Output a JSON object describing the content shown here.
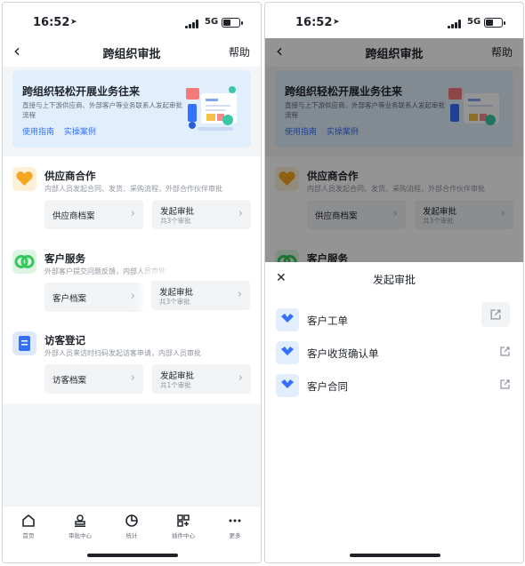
{
  "status": {
    "time": "16:52",
    "network": "5G"
  },
  "nav": {
    "back_icon": "chevron-left-icon",
    "title": "跨组织审批",
    "help": "帮助"
  },
  "banner": {
    "title": "跨组织轻松开展业务往来",
    "description": "直接与上下游供应商、外部客户等业务联系人发起审批流程",
    "links": [
      "使用指南",
      "实操案例"
    ]
  },
  "sections": [
    {
      "icon": "heart-handshake-icon",
      "color": "#f5a623",
      "title": "供应商合作",
      "description": "内部人员发起合同、发货、采购流程，外部合作伙伴审批",
      "archive": "供应商档案",
      "start": "发起审批",
      "count": "共3个审批"
    },
    {
      "icon": "two-circles-icon",
      "color": "#34c759",
      "title": "客户服务",
      "description": "外部客户提交问题反馈，内部人员审批",
      "archive": "客户档案",
      "start": "发起审批",
      "count": "共3个审批"
    },
    {
      "icon": "visitor-form-icon",
      "color": "#3370ff",
      "title": "访客登记",
      "description": "外部人员来访时扫码发起访客申请，内部人员审批",
      "archive": "访客档案",
      "start": "发起审批",
      "count": "共1个审批"
    }
  ],
  "tabs": [
    {
      "label": "首页",
      "icon": "home-icon"
    },
    {
      "label": "审批中心",
      "icon": "stamp-icon"
    },
    {
      "label": "统计",
      "icon": "pie-chart-icon"
    },
    {
      "label": "插件中心",
      "icon": "grid-plus-icon"
    },
    {
      "label": "更多",
      "icon": "more-dots-icon"
    }
  ],
  "sheet": {
    "close_icon": "close-icon",
    "title": "发起审批",
    "items": [
      {
        "label": "客户工单",
        "icon": "approval-form-icon"
      },
      {
        "label": "客户收货确认单",
        "icon": "approval-form-icon"
      },
      {
        "label": "客户合同",
        "icon": "approval-form-icon"
      }
    ]
  },
  "colors": {
    "accent": "#3370ff",
    "banner_bg": "#e1eefc",
    "pill_bg": "#f2f3f5"
  }
}
